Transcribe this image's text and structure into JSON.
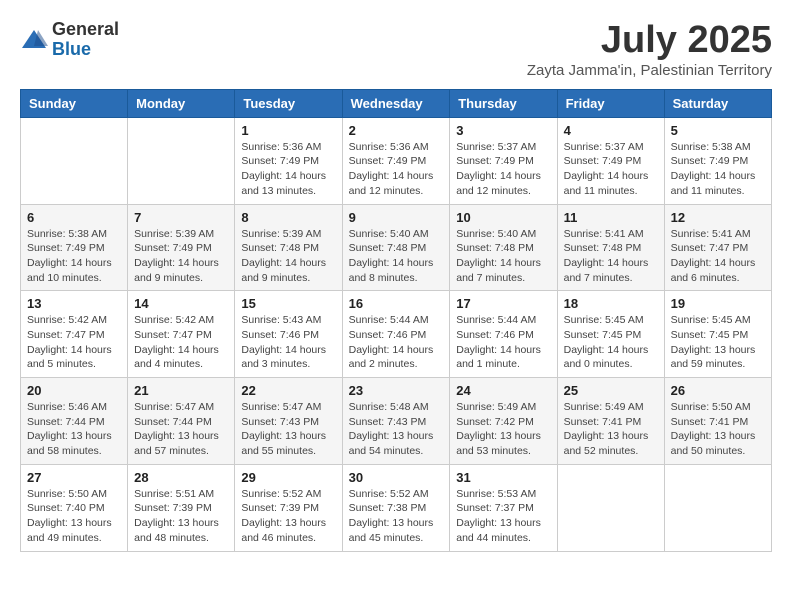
{
  "logo": {
    "general": "General",
    "blue": "Blue"
  },
  "header": {
    "month": "July 2025",
    "location": "Zayta Jamma'in, Palestinian Territory"
  },
  "days_of_week": [
    "Sunday",
    "Monday",
    "Tuesday",
    "Wednesday",
    "Thursday",
    "Friday",
    "Saturday"
  ],
  "weeks": [
    [
      {
        "day": "",
        "info": ""
      },
      {
        "day": "",
        "info": ""
      },
      {
        "day": "1",
        "info": "Sunrise: 5:36 AM\nSunset: 7:49 PM\nDaylight: 14 hours and 13 minutes."
      },
      {
        "day": "2",
        "info": "Sunrise: 5:36 AM\nSunset: 7:49 PM\nDaylight: 14 hours and 12 minutes."
      },
      {
        "day": "3",
        "info": "Sunrise: 5:37 AM\nSunset: 7:49 PM\nDaylight: 14 hours and 12 minutes."
      },
      {
        "day": "4",
        "info": "Sunrise: 5:37 AM\nSunset: 7:49 PM\nDaylight: 14 hours and 11 minutes."
      },
      {
        "day": "5",
        "info": "Sunrise: 5:38 AM\nSunset: 7:49 PM\nDaylight: 14 hours and 11 minutes."
      }
    ],
    [
      {
        "day": "6",
        "info": "Sunrise: 5:38 AM\nSunset: 7:49 PM\nDaylight: 14 hours and 10 minutes."
      },
      {
        "day": "7",
        "info": "Sunrise: 5:39 AM\nSunset: 7:49 PM\nDaylight: 14 hours and 9 minutes."
      },
      {
        "day": "8",
        "info": "Sunrise: 5:39 AM\nSunset: 7:48 PM\nDaylight: 14 hours and 9 minutes."
      },
      {
        "day": "9",
        "info": "Sunrise: 5:40 AM\nSunset: 7:48 PM\nDaylight: 14 hours and 8 minutes."
      },
      {
        "day": "10",
        "info": "Sunrise: 5:40 AM\nSunset: 7:48 PM\nDaylight: 14 hours and 7 minutes."
      },
      {
        "day": "11",
        "info": "Sunrise: 5:41 AM\nSunset: 7:48 PM\nDaylight: 14 hours and 7 minutes."
      },
      {
        "day": "12",
        "info": "Sunrise: 5:41 AM\nSunset: 7:47 PM\nDaylight: 14 hours and 6 minutes."
      }
    ],
    [
      {
        "day": "13",
        "info": "Sunrise: 5:42 AM\nSunset: 7:47 PM\nDaylight: 14 hours and 5 minutes."
      },
      {
        "day": "14",
        "info": "Sunrise: 5:42 AM\nSunset: 7:47 PM\nDaylight: 14 hours and 4 minutes."
      },
      {
        "day": "15",
        "info": "Sunrise: 5:43 AM\nSunset: 7:46 PM\nDaylight: 14 hours and 3 minutes."
      },
      {
        "day": "16",
        "info": "Sunrise: 5:44 AM\nSunset: 7:46 PM\nDaylight: 14 hours and 2 minutes."
      },
      {
        "day": "17",
        "info": "Sunrise: 5:44 AM\nSunset: 7:46 PM\nDaylight: 14 hours and 1 minute."
      },
      {
        "day": "18",
        "info": "Sunrise: 5:45 AM\nSunset: 7:45 PM\nDaylight: 14 hours and 0 minutes."
      },
      {
        "day": "19",
        "info": "Sunrise: 5:45 AM\nSunset: 7:45 PM\nDaylight: 13 hours and 59 minutes."
      }
    ],
    [
      {
        "day": "20",
        "info": "Sunrise: 5:46 AM\nSunset: 7:44 PM\nDaylight: 13 hours and 58 minutes."
      },
      {
        "day": "21",
        "info": "Sunrise: 5:47 AM\nSunset: 7:44 PM\nDaylight: 13 hours and 57 minutes."
      },
      {
        "day": "22",
        "info": "Sunrise: 5:47 AM\nSunset: 7:43 PM\nDaylight: 13 hours and 55 minutes."
      },
      {
        "day": "23",
        "info": "Sunrise: 5:48 AM\nSunset: 7:43 PM\nDaylight: 13 hours and 54 minutes."
      },
      {
        "day": "24",
        "info": "Sunrise: 5:49 AM\nSunset: 7:42 PM\nDaylight: 13 hours and 53 minutes."
      },
      {
        "day": "25",
        "info": "Sunrise: 5:49 AM\nSunset: 7:41 PM\nDaylight: 13 hours and 52 minutes."
      },
      {
        "day": "26",
        "info": "Sunrise: 5:50 AM\nSunset: 7:41 PM\nDaylight: 13 hours and 50 minutes."
      }
    ],
    [
      {
        "day": "27",
        "info": "Sunrise: 5:50 AM\nSunset: 7:40 PM\nDaylight: 13 hours and 49 minutes."
      },
      {
        "day": "28",
        "info": "Sunrise: 5:51 AM\nSunset: 7:39 PM\nDaylight: 13 hours and 48 minutes."
      },
      {
        "day": "29",
        "info": "Sunrise: 5:52 AM\nSunset: 7:39 PM\nDaylight: 13 hours and 46 minutes."
      },
      {
        "day": "30",
        "info": "Sunrise: 5:52 AM\nSunset: 7:38 PM\nDaylight: 13 hours and 45 minutes."
      },
      {
        "day": "31",
        "info": "Sunrise: 5:53 AM\nSunset: 7:37 PM\nDaylight: 13 hours and 44 minutes."
      },
      {
        "day": "",
        "info": ""
      },
      {
        "day": "",
        "info": ""
      }
    ]
  ]
}
